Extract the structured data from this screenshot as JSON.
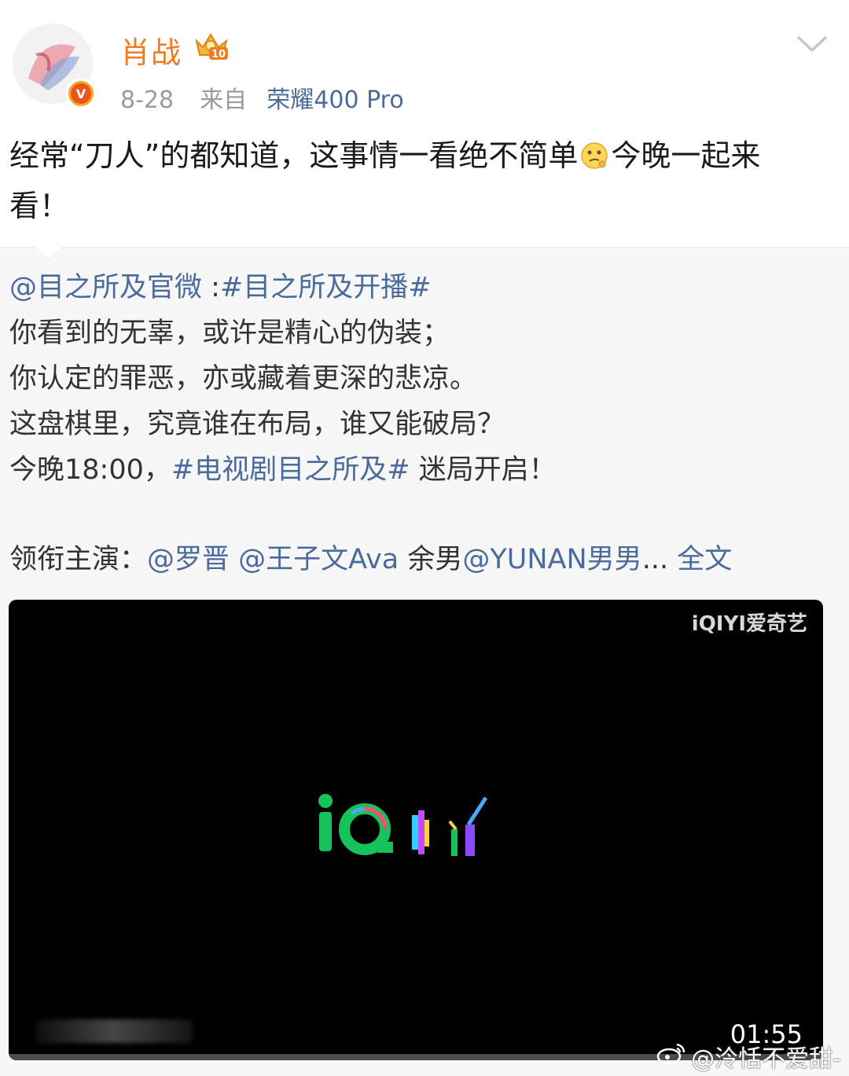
{
  "post": {
    "username": "肖战",
    "crown_level": "10",
    "date": "8-28",
    "source_prefix": "来自",
    "device": "荣耀400 Pro",
    "verified_badge": "V",
    "text_line1_a": "经常“刀人”的都知道，这事情一看绝不简单",
    "text_line1_b": "今晚一起来",
    "text_line2": "看！"
  },
  "repost": {
    "author_mention": "@目之所及官微",
    "separator": " :",
    "hashtag_main": "#目之所及开播#",
    "line1": "你看到的无辜，或许是精心的伪装；",
    "line2": "你认定的罪恶，亦或藏着更深的悲凉。",
    "line3": "这盘棋里，究竟谁在布局，谁又能破局？",
    "line4_prefix": "今晚18:00，",
    "line4_hashtag": "#电视剧目之所及#",
    "line4_suffix": " 迷局开启！",
    "cast_label": "领衔主演：",
    "cast_mention1": "@罗晋",
    "cast_mention2": "@王子文Ava",
    "cast_plain": " 余男",
    "cast_mention3": "@YUNAN男男",
    "ellipsis": "...",
    "full_text": "全文"
  },
  "video": {
    "corner_logo": "iQIYI爱奇艺",
    "duration": "01:55",
    "progress_fraction": 0.0
  },
  "watermark": {
    "text": "@泠恬不爱甜-"
  },
  "icons": {
    "chevron": "chevron-down-icon",
    "emoji": "thinking-face-emoji-icon",
    "crown": "crown-badge-icon",
    "weibo": "weibo-logo-icon"
  },
  "colors": {
    "username": "#f07b20",
    "link": "#4a6b9c",
    "meta": "#9a9a9a",
    "repost_bg": "#f7f7f7"
  }
}
